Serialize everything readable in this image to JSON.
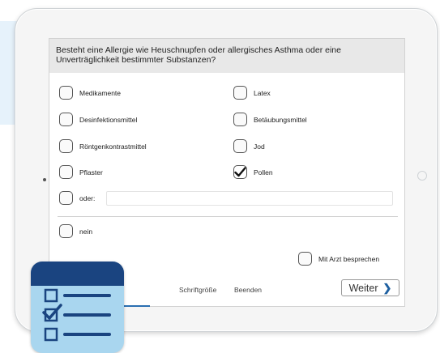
{
  "question": "Besteht eine Allergie wie Heuschnupfen oder allergisches Asthma oder eine Unverträglichkeit bestimmter Substanzen?",
  "options_left": [
    {
      "label": "Medikamente",
      "checked": false
    },
    {
      "label": "Desinfektionsmittel",
      "checked": false
    },
    {
      "label": "Röntgenkontrastmittel",
      "checked": false
    },
    {
      "label": "Pflaster",
      "checked": false
    }
  ],
  "options_right": [
    {
      "label": "Latex",
      "checked": false
    },
    {
      "label": "Betäubungsmittel",
      "checked": false
    },
    {
      "label": "Jod",
      "checked": false
    },
    {
      "label": "Pollen",
      "checked": true
    }
  ],
  "other": {
    "label": "oder:",
    "value": "",
    "checked": false
  },
  "none": {
    "label": "nein",
    "checked": false
  },
  "discuss": {
    "label": "Mit Arzt besprechen",
    "checked": false
  },
  "footer": {
    "font_size_label": "Schriftgröße",
    "quit_label": "Beenden",
    "next_label": "Weiter",
    "next_icon": "chevron-right-icon"
  },
  "app_icon": {
    "name": "checklist-icon",
    "colors": {
      "header": "#1a4480",
      "body": "#a9d6ef"
    }
  },
  "colors": {
    "accent": "#2a6fb1",
    "question_bg": "#e8e8e8"
  }
}
